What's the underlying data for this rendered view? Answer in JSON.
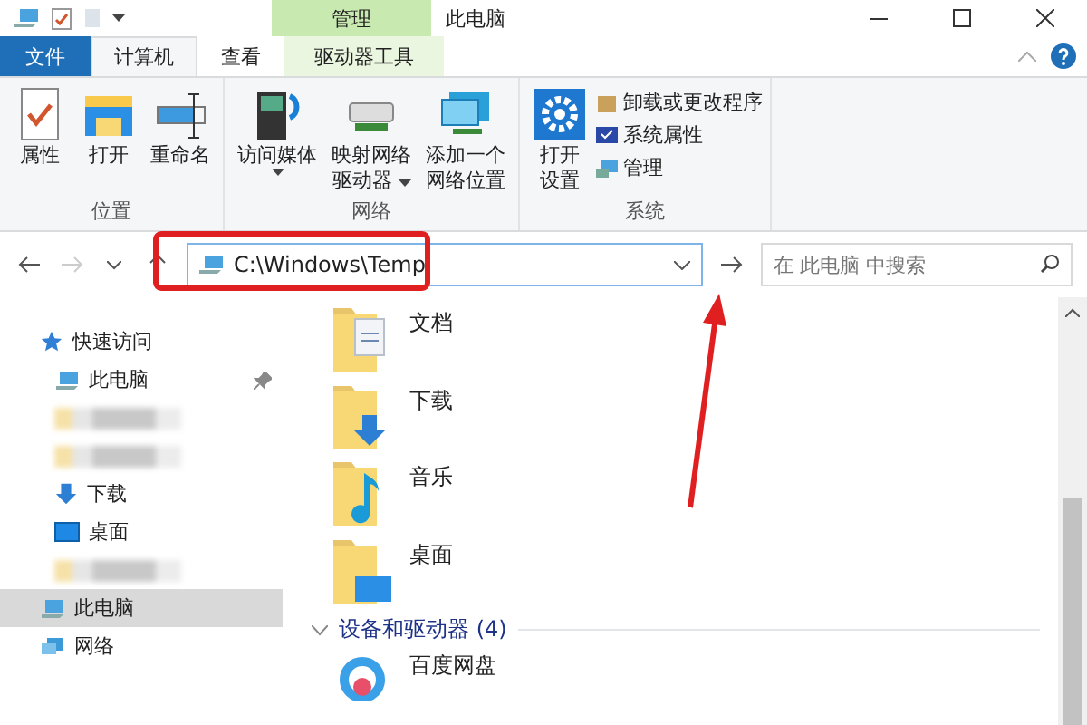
{
  "title_bar": {
    "title": "此电脑",
    "context_group": "管理"
  },
  "ribbon_tabs": [
    {
      "label": "文件",
      "kind": "file",
      "selected": false
    },
    {
      "label": "计算机",
      "kind": "tab",
      "selected": true
    },
    {
      "label": "查看",
      "kind": "tab",
      "selected": false
    },
    {
      "label": "驱动器工具",
      "kind": "context",
      "selected": false
    }
  ],
  "ribbon_groups": [
    {
      "label": "位置",
      "commands": [
        {
          "lines": [
            "属性"
          ],
          "kind": "properties",
          "dropdown": false
        },
        {
          "lines": [
            "打开"
          ],
          "kind": "folder",
          "dropdown": false
        },
        {
          "lines": [
            "重命名"
          ],
          "kind": "rename",
          "dropdown": false
        }
      ]
    },
    {
      "label": "网络",
      "commands": [
        {
          "lines": [
            "访问媒体"
          ],
          "kind": "media",
          "dropdown": true
        },
        {
          "lines": [
            "映射网络",
            "驱动器"
          ],
          "kind": "drive",
          "dropdown": true
        },
        {
          "lines": [
            "添加一个",
            "网络位置"
          ],
          "kind": "network",
          "dropdown": false
        }
      ]
    },
    {
      "label": "系统",
      "commands": [
        {
          "lines": [
            "打开",
            "设置"
          ],
          "kind": "gear",
          "dropdown": false
        }
      ],
      "small_commands": [
        {
          "label": "卸载或更改程序",
          "kind": "uninstall"
        },
        {
          "label": "系统属性",
          "kind": "sysprops"
        },
        {
          "label": "管理",
          "kind": "manage"
        }
      ]
    }
  ],
  "address_bar": {
    "path": "C:\\Windows\\Temp",
    "search_placeholder": "在 此电脑 中搜索"
  },
  "nav_pane": [
    {
      "kind": "quick",
      "label": "快速访问",
      "selected": false,
      "pinned": false
    },
    {
      "kind": "computer",
      "label": "此电脑",
      "selected": false,
      "pinned": true
    },
    {
      "kind": "blurred",
      "selected": false
    },
    {
      "kind": "blurred",
      "selected": false
    },
    {
      "kind": "downloads",
      "label": "下载",
      "selected": false,
      "pinned": false
    },
    {
      "kind": "desktop",
      "label": "桌面",
      "selected": false,
      "pinned": false
    },
    {
      "kind": "blurred",
      "selected": false
    },
    {
      "kind": "computer",
      "label": "此电脑",
      "selected": true,
      "pinned": false
    },
    {
      "kind": "network",
      "label": "网络",
      "selected": false,
      "pinned": false
    }
  ],
  "folders": [
    {
      "name": "文档",
      "kind": "documents"
    },
    {
      "name": "下载",
      "kind": "downloads"
    },
    {
      "name": "音乐",
      "kind": "music"
    },
    {
      "name": "桌面",
      "kind": "desktop"
    }
  ],
  "devices_section": {
    "title": "设备和驱动器 (4)",
    "expanded": true,
    "items": [
      {
        "name": "百度网盘"
      }
    ]
  }
}
